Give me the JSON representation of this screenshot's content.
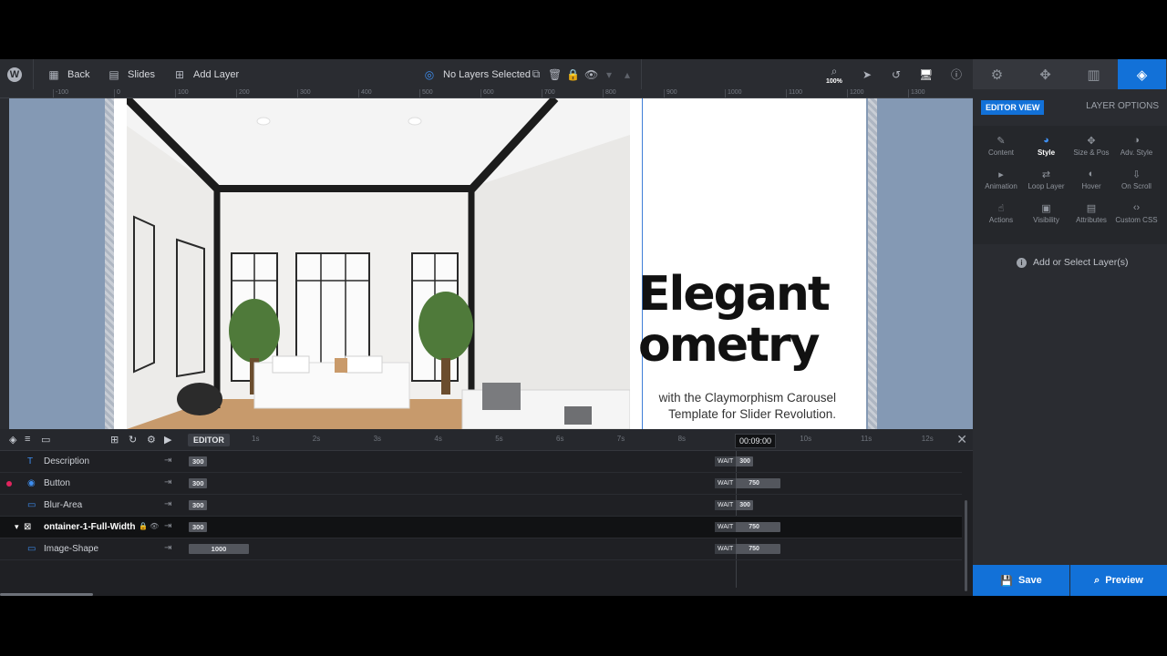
{
  "toolbar": {
    "back_label": "Back",
    "slides_label": "Slides",
    "add_layer_label": "Add Layer",
    "layers_status": "No Layers Selected",
    "zoom": "100%"
  },
  "ruler": {
    "ticks": [
      "-100",
      "0",
      "100",
      "200",
      "300",
      "400",
      "500",
      "600",
      "700",
      "800",
      "900",
      "1000",
      "1100",
      "1200",
      "1300"
    ]
  },
  "slide": {
    "headline_line1": "Elegant",
    "headline_line2": "ometry",
    "subtext_line1": "with the Claymorphism Carousel",
    "subtext_line2": "Template for Slider Revolution."
  },
  "timeline": {
    "editor_label": "EDITOR",
    "seconds": [
      "1s",
      "2s",
      "3s",
      "4s",
      "5s",
      "6s",
      "7s",
      "8s",
      "9s",
      "10s",
      "11s",
      "12s"
    ],
    "current_time": "00:09:00",
    "wait_label": "WAIT",
    "layers": [
      {
        "name": "Description",
        "start": "300",
        "wait": "300"
      },
      {
        "name": "Button",
        "start": "300",
        "wait": "750"
      },
      {
        "name": "Blur-Area",
        "start": "300",
        "wait": "300"
      },
      {
        "name": "ontainer-1-Full-Width",
        "start": "300",
        "wait": "750"
      },
      {
        "name": "Image-Shape",
        "start": "1000",
        "wait": "750"
      }
    ]
  },
  "panel": {
    "editor_view_label": "EDITOR VIEW",
    "layer_options_label": "LAYER OPTIONS",
    "options": [
      "Content",
      "Style",
      "Size & Pos",
      "Adv. Style",
      "Animation",
      "Loop Layer",
      "Hover",
      "On Scroll",
      "Actions",
      "Visibility",
      "Attributes",
      "Custom CSS"
    ],
    "add_select_label": "Add or Select Layer(s)",
    "save_label": "Save",
    "preview_label": "Preview"
  },
  "colors": {
    "accent": "#1271d8",
    "canvas_bg": "#8499b4"
  }
}
